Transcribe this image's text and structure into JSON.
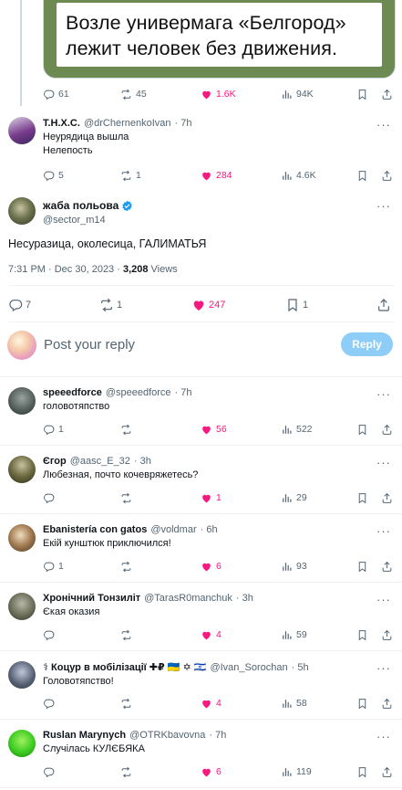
{
  "quoted_image": {
    "text_line1": "Возле универмага «Белгород»",
    "text_line2": "лежит человек без движения."
  },
  "top_stats": {
    "replies": "61",
    "reposts": "45",
    "likes": "1.6K",
    "views": "94K"
  },
  "reply_thnxc": {
    "name": "Т.Н.Х.С.",
    "handle": "@drChernenkoIvan",
    "time": "· 7h",
    "line1": "Неурядица вышла",
    "line2": "Нелепость",
    "replies": "5",
    "reposts": "1",
    "likes": "284",
    "views": "4.6K"
  },
  "main": {
    "name": "жаба польова",
    "handle": "@sector_m14",
    "text": "Несуразица, околесица, ГАЛИМАТЬЯ",
    "timestamp": "7:31 PM · Dec 30, 2023 · ",
    "views_count": "3,208",
    "views_label": " Views",
    "replies": "7",
    "reposts": "1",
    "likes": "247",
    "bookmarks": "1"
  },
  "compose": {
    "placeholder": "Post your reply",
    "button": "Reply"
  },
  "replies": [
    {
      "name": "speeedforce",
      "handle": "@speeedforce",
      "time": "· 7h",
      "text": "головотяпство",
      "replies": "1",
      "reposts": "",
      "likes": "56",
      "views": "522"
    },
    {
      "name": "Єгор",
      "handle": "@aasc_E_32",
      "time": "· 3h",
      "text": "Любезная, почто кочевряжетесь?",
      "replies": "",
      "reposts": "",
      "likes": "1",
      "views": "29"
    },
    {
      "name": "Ebanistería con gatos",
      "handle": "@voldmar",
      "time": "· 6h",
      "text": "Екій кунштюк приключился!",
      "replies": "1",
      "reposts": "",
      "likes": "6",
      "views": "93"
    },
    {
      "name": "Хронічний Тонзиліт",
      "handle": "@TarasR0manchuk",
      "time": "· 3h",
      "text": "Єкая оказия",
      "replies": "",
      "reposts": "",
      "likes": "4",
      "views": "59"
    },
    {
      "name": "⚕ Коцур в мобілізації ✚₽ 🇺🇦 ✡ 🇮🇱",
      "handle": "@Ivan_Sorochan",
      "time": "· 5h",
      "text": "Головотяпство!",
      "replies": "",
      "reposts": "",
      "likes": "4",
      "views": "58"
    },
    {
      "name": "Ruslan Marynych",
      "handle": "@OTRKbavovna",
      "time": "· 7h",
      "text": "Случілась КУЛЄБЯКА",
      "replies": "",
      "reposts": "",
      "likes": "6",
      "views": "119"
    }
  ],
  "colors": {
    "like": "#f91880",
    "verified": "#1d9bf0",
    "muted": "#536471",
    "reply_button": "#8ecdf8"
  }
}
